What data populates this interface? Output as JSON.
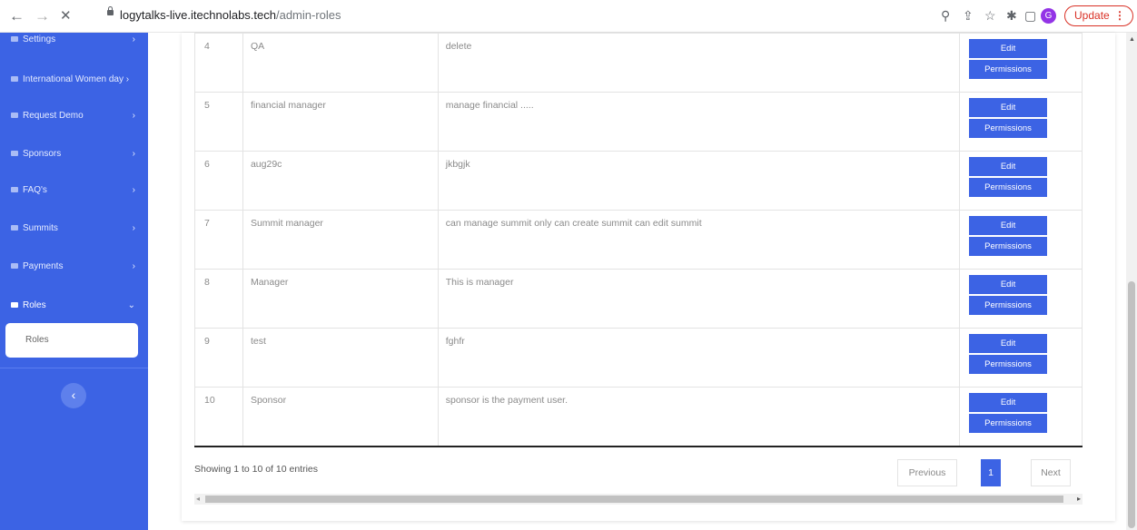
{
  "browser": {
    "back": "←",
    "forward": "→",
    "close": "✕",
    "url_host": "logytalks-live.itechnolabs.tech",
    "url_path": "/admin-roles",
    "zoom_icon": "⚲",
    "share_icon": "⇪",
    "star_icon": "☆",
    "ext_icon": "✱",
    "sidepanel_icon": "▢",
    "profile_initial": "G",
    "update_label": "Update",
    "update_dots": "⋮"
  },
  "sidebar": {
    "items": [
      {
        "label": "Settings",
        "chevron": "›"
      },
      {
        "label": "International Women day",
        "chevron": "›"
      },
      {
        "label": "Request Demo",
        "chevron": "›"
      },
      {
        "label": "Sponsors",
        "chevron": "›"
      },
      {
        "label": "FAQ's",
        "chevron": "›"
      },
      {
        "label": "Summits",
        "chevron": "›"
      },
      {
        "label": "Payments",
        "chevron": "›"
      },
      {
        "label": "Roles",
        "chevron": "⌄"
      }
    ],
    "sub_item": "Roles",
    "collapse": "‹"
  },
  "table": {
    "rows": [
      {
        "num": "4",
        "name": "QA",
        "desc": "delete"
      },
      {
        "num": "5",
        "name": "financial manager",
        "desc": "manage financial ....."
      },
      {
        "num": "6",
        "name": "aug29c",
        "desc": "jkbgjk"
      },
      {
        "num": "7",
        "name": "Summit manager",
        "desc": "can manage summit only can create summit can edit summit"
      },
      {
        "num": "8",
        "name": "Manager",
        "desc": "This is manager"
      },
      {
        "num": "9",
        "name": "test",
        "desc": "fghfr"
      },
      {
        "num": "10",
        "name": "Sponsor",
        "desc": "sponsor is the payment user."
      }
    ],
    "edit_label": "Edit",
    "permissions_label": "Permissions"
  },
  "footer": {
    "info": "Showing 1 to 10 of 10 entries",
    "prev": "Previous",
    "page": "1",
    "next": "Next",
    "left_arrow": "◂",
    "right_arrow": "▸"
  },
  "scroll": {
    "up_arrow": "▲"
  },
  "colors": {
    "accent": "#3c63e4",
    "sidebar": "#3c63e4"
  }
}
